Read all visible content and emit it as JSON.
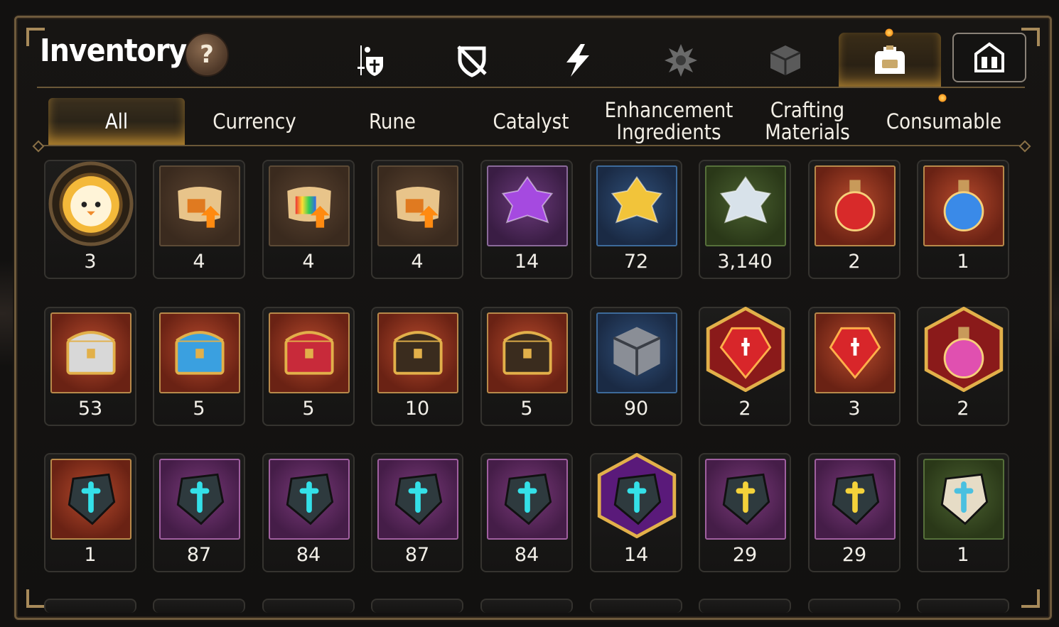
{
  "title": "Inventory",
  "help_label": "?",
  "category_tabs": [
    {
      "icon": "sword-shield-icon",
      "active": false
    },
    {
      "icon": "broken-shield-icon",
      "active": false
    },
    {
      "icon": "lightning-icon",
      "active": false
    },
    {
      "icon": "spiky-emblem-icon",
      "active": false
    },
    {
      "icon": "cube-icon",
      "active": false
    },
    {
      "icon": "backpack-icon",
      "active": true
    },
    {
      "icon": "guild-castle-icon",
      "active": false
    }
  ],
  "sub_tabs": [
    {
      "label": "All",
      "active": true
    },
    {
      "label": "Currency",
      "active": false
    },
    {
      "label": "Rune",
      "active": false
    },
    {
      "label": "Catalyst",
      "active": false
    },
    {
      "label": "Enhancement\nIngredients",
      "active": false
    },
    {
      "label": "Crafting\nMaterials",
      "active": false
    },
    {
      "label": "Consumable",
      "active": false
    }
  ],
  "items": [
    {
      "icon": "chick-portrait-icon",
      "frame": "circle",
      "count": "3"
    },
    {
      "icon": "upgrade-scroll-icon",
      "frame": "brown",
      "count": "4"
    },
    {
      "icon": "rainbow-upgrade-scroll-icon",
      "frame": "brown",
      "count": "4"
    },
    {
      "icon": "upgrade-scroll-icon",
      "frame": "brown",
      "count": "4"
    },
    {
      "icon": "purple-crystal-icon",
      "frame": "purple",
      "count": "14"
    },
    {
      "icon": "gold-crystal-icon",
      "frame": "blue",
      "count": "72"
    },
    {
      "icon": "silver-crystal-icon",
      "frame": "green",
      "count": "3,140"
    },
    {
      "icon": "red-potion-icon",
      "frame": "red",
      "count": "2"
    },
    {
      "icon": "blue-star-potion-icon",
      "frame": "red",
      "count": "1"
    },
    {
      "icon": "silver-chest-icon",
      "frame": "red",
      "count": "53"
    },
    {
      "icon": "blue-chest-icon",
      "frame": "red",
      "count": "5"
    },
    {
      "icon": "red-chest-icon",
      "frame": "red",
      "count": "5"
    },
    {
      "icon": "treasure-chest-icon",
      "frame": "red",
      "count": "10"
    },
    {
      "icon": "treasure-chest-icon",
      "frame": "red",
      "count": "5"
    },
    {
      "icon": "grey-cube-icon",
      "frame": "blue",
      "count": "90"
    },
    {
      "icon": "red-gem-icon",
      "frame": "hex",
      "count": "2"
    },
    {
      "icon": "red-hammer-gem-icon",
      "frame": "red",
      "count": "3"
    },
    {
      "icon": "pink-potion-icon",
      "frame": "hex",
      "count": "2"
    },
    {
      "icon": "blue-hammer-rune-icon",
      "frame": "red",
      "count": "1"
    },
    {
      "icon": "sword-rune-icon",
      "frame": "violet",
      "count": "87"
    },
    {
      "icon": "helmet-rune-icon",
      "frame": "violet",
      "count": "84"
    },
    {
      "icon": "armor-rune-icon",
      "frame": "violet",
      "count": "87"
    },
    {
      "icon": "boot-rune-icon",
      "frame": "violet",
      "count": "84"
    },
    {
      "icon": "star-rune-icon",
      "frame": "hex",
      "count": "14"
    },
    {
      "icon": "gold-hammer-rune-icon",
      "frame": "violet",
      "count": "29"
    },
    {
      "icon": "gold-sword-rune-icon",
      "frame": "violet",
      "count": "29"
    },
    {
      "icon": "stone-sword-rune-icon",
      "frame": "green",
      "count": "1"
    }
  ],
  "colors": {
    "accent_gold": "#e0a83a",
    "frame_border": "#6e5a3c",
    "text": "#f2efe8"
  }
}
